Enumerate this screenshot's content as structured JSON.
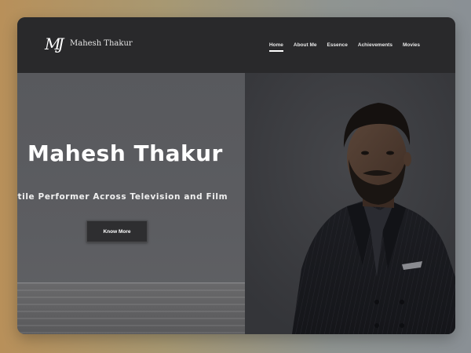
{
  "brand": {
    "mark": "MJ",
    "name": "Mahesh Thakur"
  },
  "nav": {
    "items": [
      {
        "label": "Home",
        "active": true
      },
      {
        "label": "About Me",
        "active": false
      },
      {
        "label": "Essence",
        "active": false
      },
      {
        "label": "Achievements",
        "active": false
      },
      {
        "label": "Movies",
        "active": false
      }
    ]
  },
  "hero": {
    "title": "Mahesh Thakur",
    "subtitle": "satile Performer Across Television and Film",
    "button_label": "Know More"
  },
  "colors": {
    "navbar_bg": "#29292b",
    "hero_left_bg": "#5a5b5f",
    "hero_right_bg": "#3b3c40",
    "button_bg": "#2e2e30",
    "text": "#ffffff"
  },
  "icons": {
    "logo": "mj-monogram-icon"
  }
}
